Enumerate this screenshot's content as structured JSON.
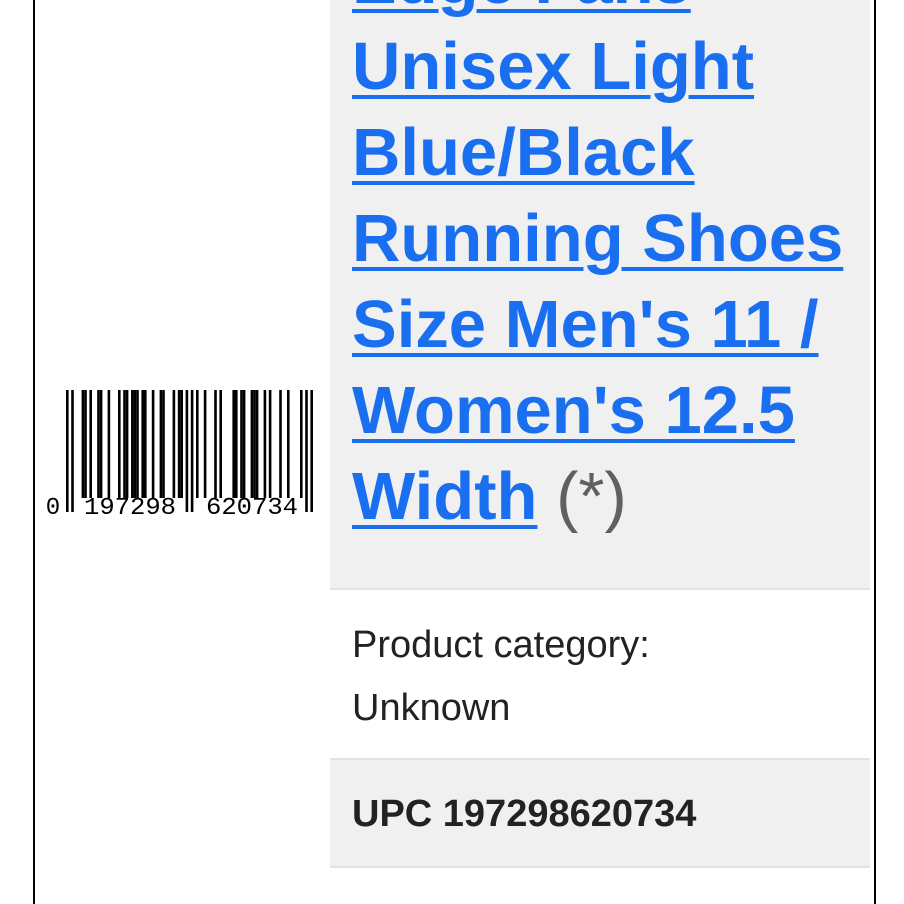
{
  "product": {
    "title_line_partial": "Edge Fans",
    "title_lines": [
      "Unisex Light",
      "Blue/Black",
      "Running Shoes",
      "Size Men's 11 /",
      "Women's 12.5",
      "Width"
    ],
    "title_marker": "(*)",
    "category_label": "Product category:",
    "category_value": "Unknown",
    "upc_label": "UPC 197298620734"
  },
  "barcode": {
    "digit_lead": "0",
    "digits_left": "197298",
    "digits_right": "620734",
    "digit_check": "",
    "bar_color": "#000000"
  },
  "colors": {
    "link": "#1a6ff0",
    "cell_shaded": "#f0f0f0",
    "text": "#222222",
    "marker": "#606060"
  }
}
